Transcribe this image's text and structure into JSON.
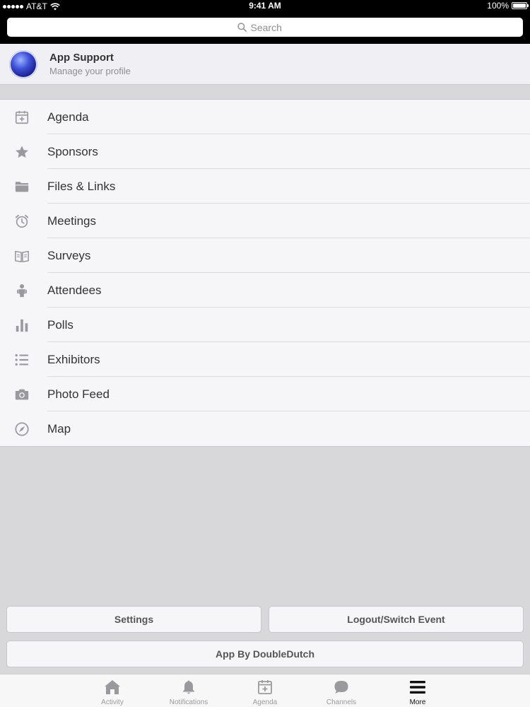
{
  "status_bar": {
    "carrier": "AT&T",
    "time": "9:41 AM",
    "battery_text": "100%",
    "battery_level": 1.0
  },
  "search": {
    "placeholder": "Search",
    "value": ""
  },
  "profile": {
    "name": "App Support",
    "subtitle": "Manage your profile"
  },
  "menu": {
    "items": [
      {
        "label": "Agenda",
        "icon": "calendar-icon"
      },
      {
        "label": "Sponsors",
        "icon": "star-icon"
      },
      {
        "label": "Files & Links",
        "icon": "folder-icon"
      },
      {
        "label": "Meetings",
        "icon": "alarm-clock-icon"
      },
      {
        "label": "Surveys",
        "icon": "open-book-icon"
      },
      {
        "label": "Attendees",
        "icon": "person-icon"
      },
      {
        "label": "Polls",
        "icon": "bar-chart-icon"
      },
      {
        "label": "Exhibitors",
        "icon": "list-icon"
      },
      {
        "label": "Photo Feed",
        "icon": "camera-icon"
      },
      {
        "label": "Map",
        "icon": "compass-icon"
      }
    ]
  },
  "buttons": {
    "settings": "Settings",
    "logout": "Logout/Switch Event",
    "credit": "App By DoubleDutch"
  },
  "tabs": [
    {
      "label": "Activity",
      "icon": "home-icon",
      "active": false
    },
    {
      "label": "Notifications",
      "icon": "bell-icon",
      "active": false
    },
    {
      "label": "Agenda",
      "icon": "calendar-icon",
      "active": false
    },
    {
      "label": "Channels",
      "icon": "chat-bubble-icon",
      "active": false
    },
    {
      "label": "More",
      "icon": "hamburger-menu-icon",
      "active": true
    }
  ],
  "colors": {
    "header_bg": "#000000",
    "icon_gray": "#9a9a9e",
    "active_tab": "#111111"
  }
}
